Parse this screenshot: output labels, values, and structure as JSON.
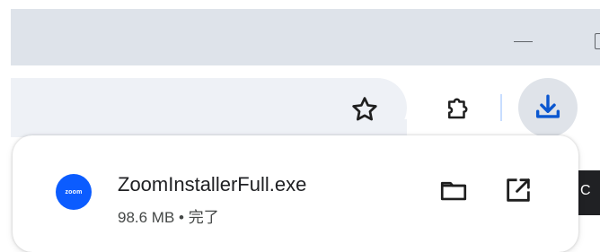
{
  "toolbar": {
    "bookmark_icon": "star-outline-icon",
    "extensions_icon": "puzzle-icon",
    "download_icon": "download-icon",
    "accent_color": "#0b57d0"
  },
  "download_item": {
    "app_icon_text": "zoom",
    "app_icon_color": "#0b5cff",
    "file_name": "ZoomInstallerFull.exe",
    "status": "98.6 MB • 完了",
    "folder_icon": "folder-icon",
    "open_icon": "open-external-icon"
  },
  "side_fragment": {
    "text": "C"
  }
}
